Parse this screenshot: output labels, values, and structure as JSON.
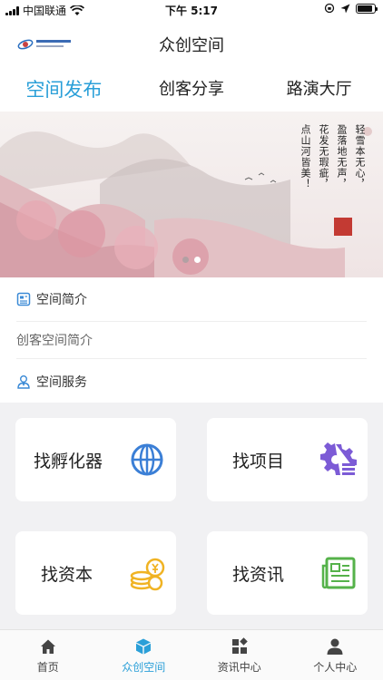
{
  "status_bar": {
    "carrier": "中国联通",
    "time": "下午 5:17"
  },
  "header": {
    "title": "众创空间",
    "logo_text": "高新电子信息产业园"
  },
  "top_tabs": [
    {
      "label": "空间发布",
      "active": true
    },
    {
      "label": "创客分享",
      "active": false
    },
    {
      "label": "路演大厅",
      "active": false
    }
  ],
  "banner": {
    "poem_columns": [
      "轻雪本无心，",
      "盈落地无声，",
      "花发无瑕疵，",
      "点山河皆美！"
    ],
    "dot_count": 2,
    "active_dot": 1
  },
  "space_intro": {
    "heading": "空间简介",
    "text": "创客空间简介"
  },
  "space_services": {
    "heading": "空间服务",
    "cards": [
      {
        "label": "找孵化器",
        "icon": "globe-icon",
        "color": "#3b7fd6"
      },
      {
        "label": "找项目",
        "icon": "gear-list-icon",
        "color": "#7c5bd6"
      },
      {
        "label": "找资本",
        "icon": "coins-icon",
        "color": "#f0b323"
      },
      {
        "label": "找资讯",
        "icon": "newspaper-icon",
        "color": "#55b24a"
      }
    ]
  },
  "bottom_tabs": [
    {
      "label": "首页",
      "icon": "home-icon",
      "active": false
    },
    {
      "label": "众创空间",
      "icon": "cube-icon",
      "active": true
    },
    {
      "label": "资讯中心",
      "icon": "grid-icon",
      "active": false
    },
    {
      "label": "个人中心",
      "icon": "user-icon",
      "active": false
    }
  ],
  "colors": {
    "accent": "#2a9fd8",
    "grid_background": "#f1f1f3"
  }
}
